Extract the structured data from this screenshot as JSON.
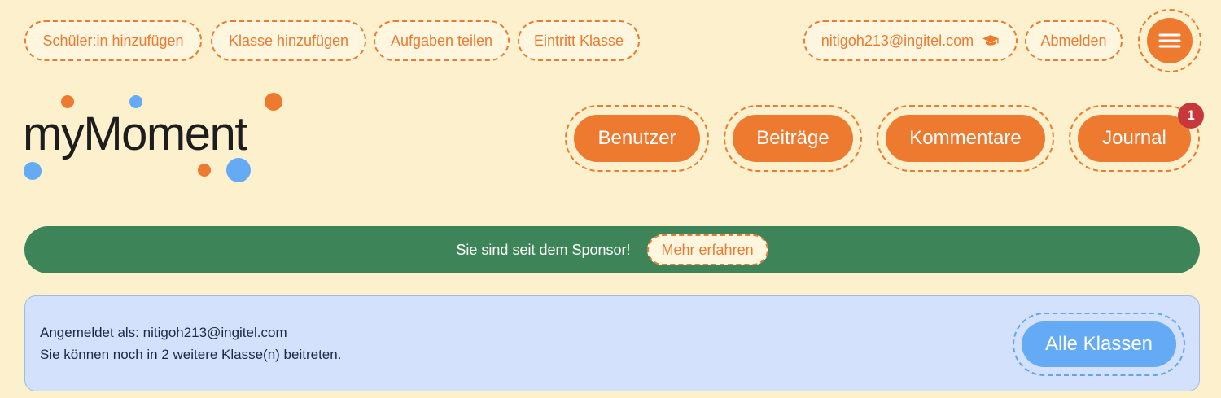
{
  "top_nav": {
    "add_student": "Schüler:in hinzufügen",
    "add_class": "Klasse hinzufügen",
    "share_tasks": "Aufgaben teilen",
    "join_class": "Eintritt Klasse",
    "user_email": "nitigoh213@ingitel.com",
    "logout": "Abmelden"
  },
  "logo": {
    "text": "myMoment"
  },
  "main_nav": {
    "users": "Benutzer",
    "posts": "Beiträge",
    "comments": "Kommentare",
    "journal": "Journal",
    "journal_badge": "1"
  },
  "banner": {
    "text": "Sie sind seit dem Sponsor!",
    "button": "Mehr erfahren"
  },
  "info": {
    "logged_in": "Angemeldet als: nitigoh213@ingitel.com",
    "remaining": "Sie können noch in 2 weitere Klasse(n) beitreten.",
    "all_classes": "Alle Klassen"
  },
  "icons": {
    "user": "graduation-cap-icon",
    "menu": "hamburger-menu-icon"
  },
  "colors": {
    "background": "#fdf0cc",
    "accent": "#ee7a2f",
    "banner": "#3d8558",
    "info_bg": "#d3e1fc",
    "info_button": "#64aaf5",
    "badge": "#c8383a"
  }
}
